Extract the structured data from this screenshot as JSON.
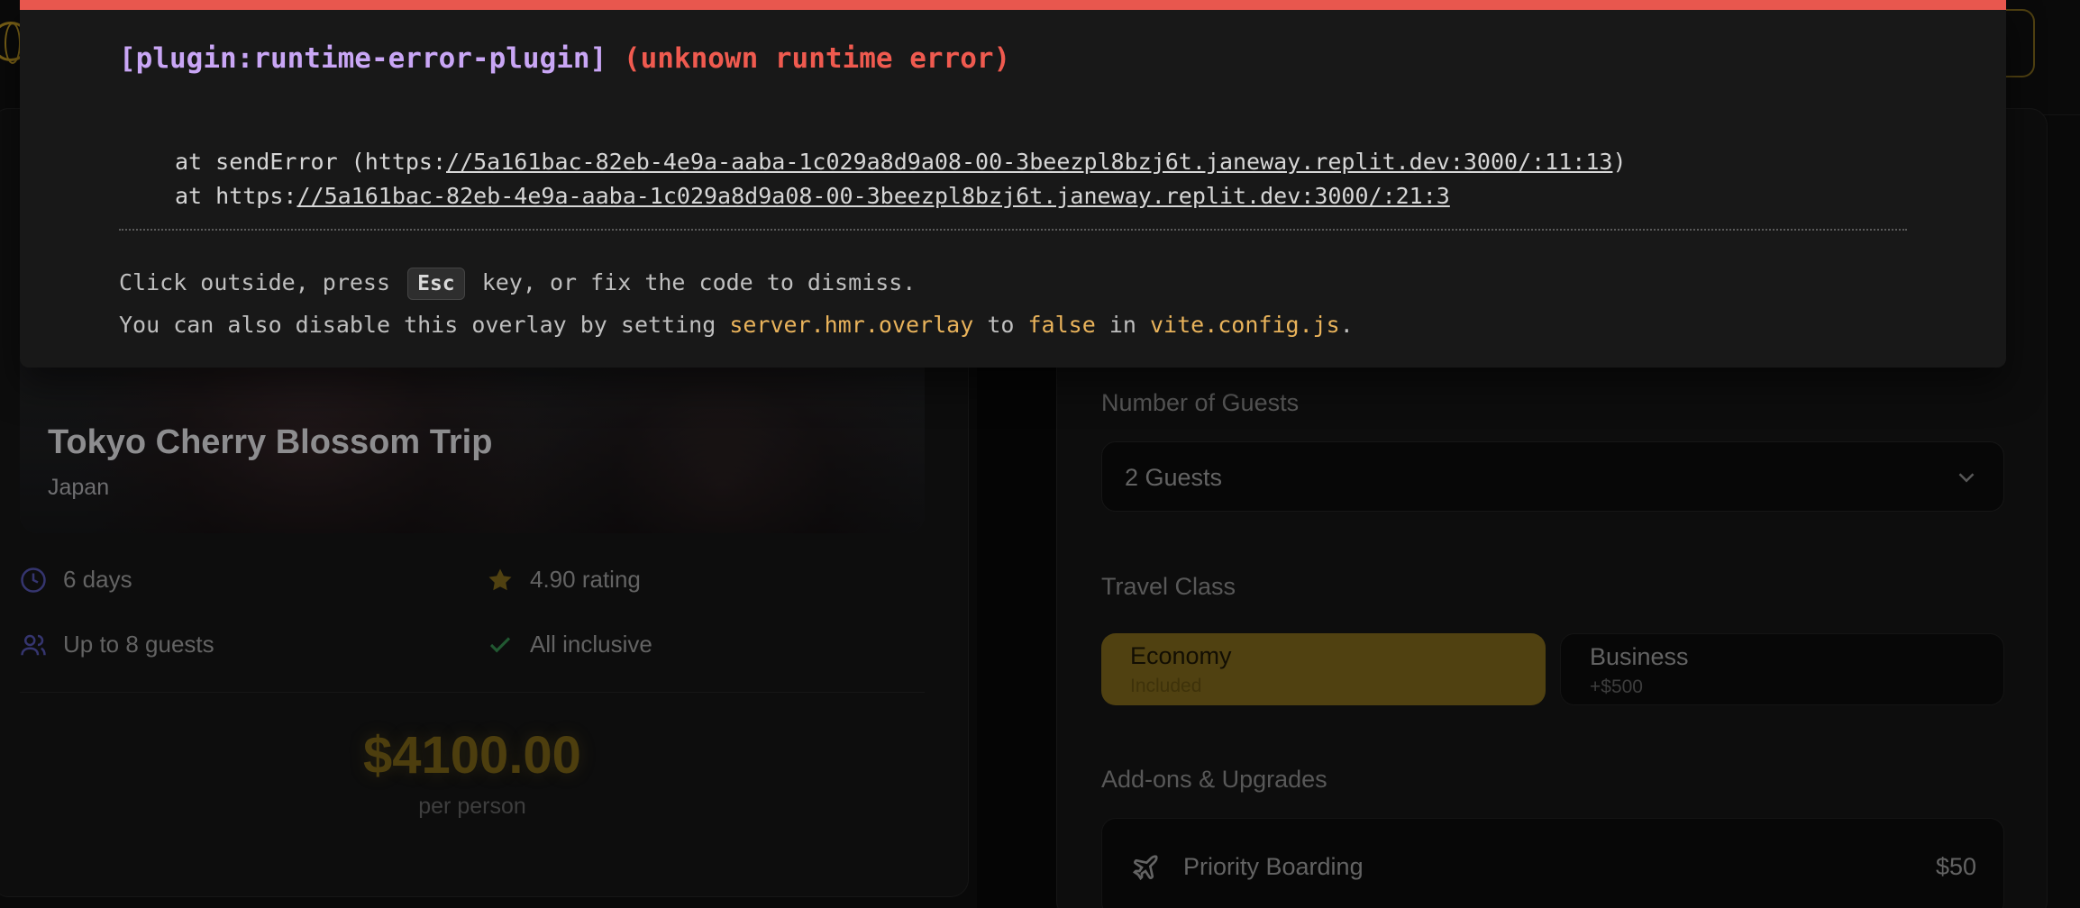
{
  "trip": {
    "title": "Tokyo Cherry Blossom Trip",
    "country": "Japan",
    "features": {
      "duration": "6 days",
      "rating": "4.90 rating",
      "guests": "Up to 8 guests",
      "inclusive": "All inclusive"
    },
    "price": "$4100.00",
    "price_unit": "per person"
  },
  "booking": {
    "guests_label": "Number of Guests",
    "guests_value": "2 Guests",
    "class_label": "Travel Class",
    "classes": [
      {
        "name": "Economy",
        "sub": "Included"
      },
      {
        "name": "Business",
        "sub": "+$500"
      }
    ],
    "addons_label": "Add-ons & Upgrades",
    "addons": [
      {
        "name": "Priority Boarding",
        "price": "$50"
      }
    ]
  },
  "error_overlay": {
    "plugin": "[plugin:runtime-error-plugin]",
    "message": "(unknown runtime error)",
    "stack": [
      {
        "prefix": "at sendError (https:",
        "link": "//5a161bac-82eb-4e9a-aaba-1c029a8d9a08-00-3beezpl8bzj6t.janeway.replit.dev:3000/:11:13",
        "suffix": ")"
      },
      {
        "prefix": "at https:",
        "link": "//5a161bac-82eb-4e9a-aaba-1c029a8d9a08-00-3beezpl8bzj6t.janeway.replit.dev:3000/:21:3",
        "suffix": ""
      }
    ],
    "tip1_before": "Click outside, press",
    "tip1_key": "Esc",
    "tip1_after": "key, or fix the code to dismiss.",
    "tip2_part1": "You can also disable this overlay by setting",
    "tip2_code1": "server.hmr.overlay",
    "tip2_part2": "to",
    "tip2_code2": "false",
    "tip2_part3": "in",
    "tip2_code3": "vite.config.js",
    "tip2_end": "."
  },
  "colors": {
    "accent_gold": "#a8861f",
    "error_red": "#e8574e",
    "plugin_purple": "#c9a6f5",
    "code_yellow": "#e9b35b"
  }
}
